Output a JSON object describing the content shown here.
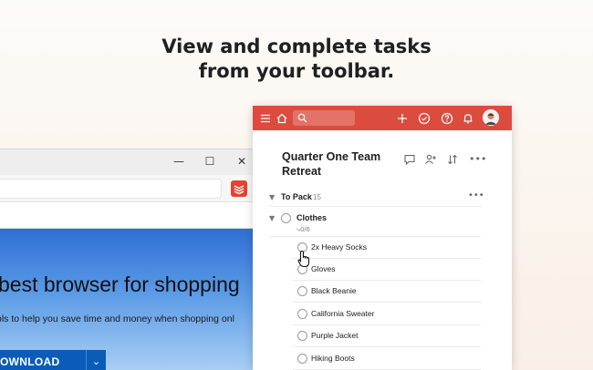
{
  "headline": {
    "line1": "View and complete tasks",
    "line2": "from your toolbar."
  },
  "browser": {
    "hero_title": "best browser for shopping",
    "hero_subtitle": "ols to help you save time and money when shopping onl",
    "download_label": "OWNLOAD",
    "window_controls": [
      "minimize-icon",
      "maximize-icon",
      "close-icon"
    ]
  },
  "popup": {
    "accent": "#db4c3f",
    "toolbar_icons": [
      "menu-icon",
      "home-icon",
      "search-icon",
      "add-icon",
      "check-icon",
      "help-icon",
      "bell-icon",
      "avatar"
    ],
    "project_title": "Quarter One Team Retreat",
    "project_icons": [
      "comment-icon",
      "add-person-icon",
      "sort-icon",
      "more-icon"
    ],
    "section": {
      "name": "To Pack",
      "count": "15"
    },
    "parent_task": {
      "name": "Clothes",
      "meta": "0/6"
    },
    "subtasks": [
      {
        "name": "2x Heavy Socks"
      },
      {
        "name": "Gloves"
      },
      {
        "name": "Black Beanie"
      },
      {
        "name": "California Sweater"
      },
      {
        "name": "Purple Jacket"
      },
      {
        "name": "Hiking Boots"
      }
    ]
  }
}
